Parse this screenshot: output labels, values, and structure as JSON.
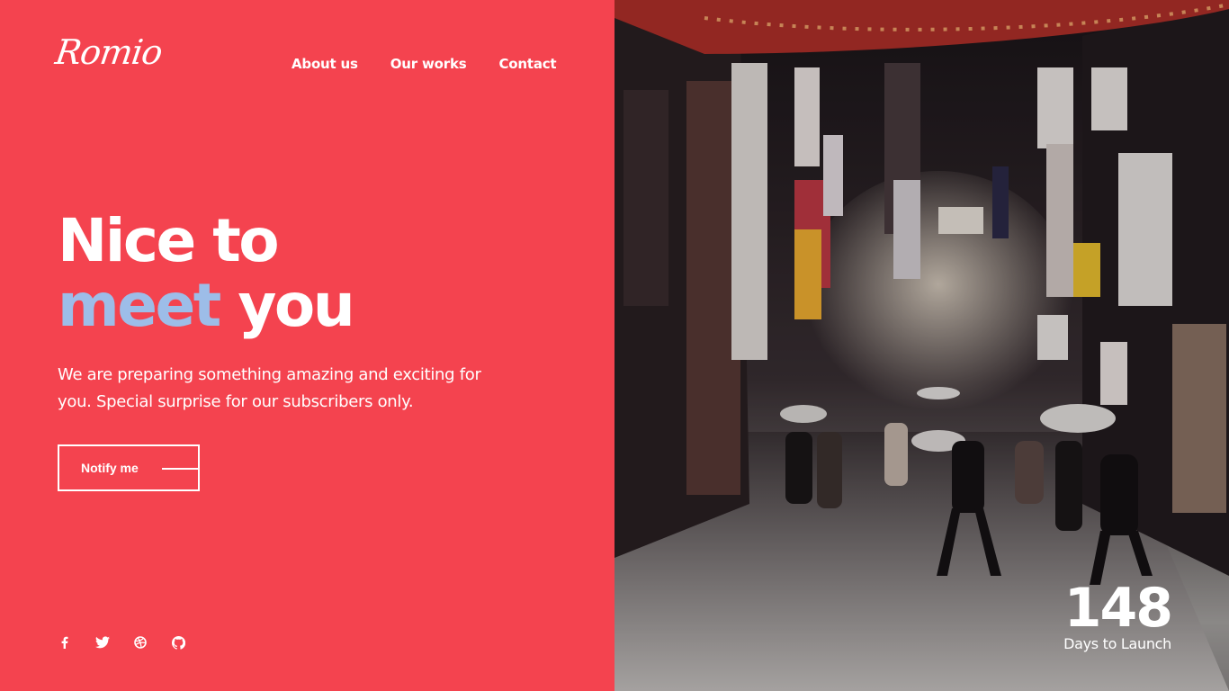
{
  "brand": {
    "logo_text": "Romio"
  },
  "nav": {
    "items": [
      "About us",
      "Our works",
      "Contact"
    ]
  },
  "hero": {
    "line1": "Nice to",
    "accent_word": "meet",
    "line2_rest": "you",
    "description": "We are preparing something amazing and exciting for you. Special surprise for our subscribers only."
  },
  "cta": {
    "label": "Notify me"
  },
  "social": {
    "icons": [
      "facebook-icon",
      "twitter-icon",
      "dribbble-icon",
      "github-icon"
    ]
  },
  "countdown": {
    "value": "148",
    "label": "Days to Launch"
  },
  "colors": {
    "background": "#f4434f",
    "accent": "#9dbde8",
    "text": "#ffffff"
  }
}
